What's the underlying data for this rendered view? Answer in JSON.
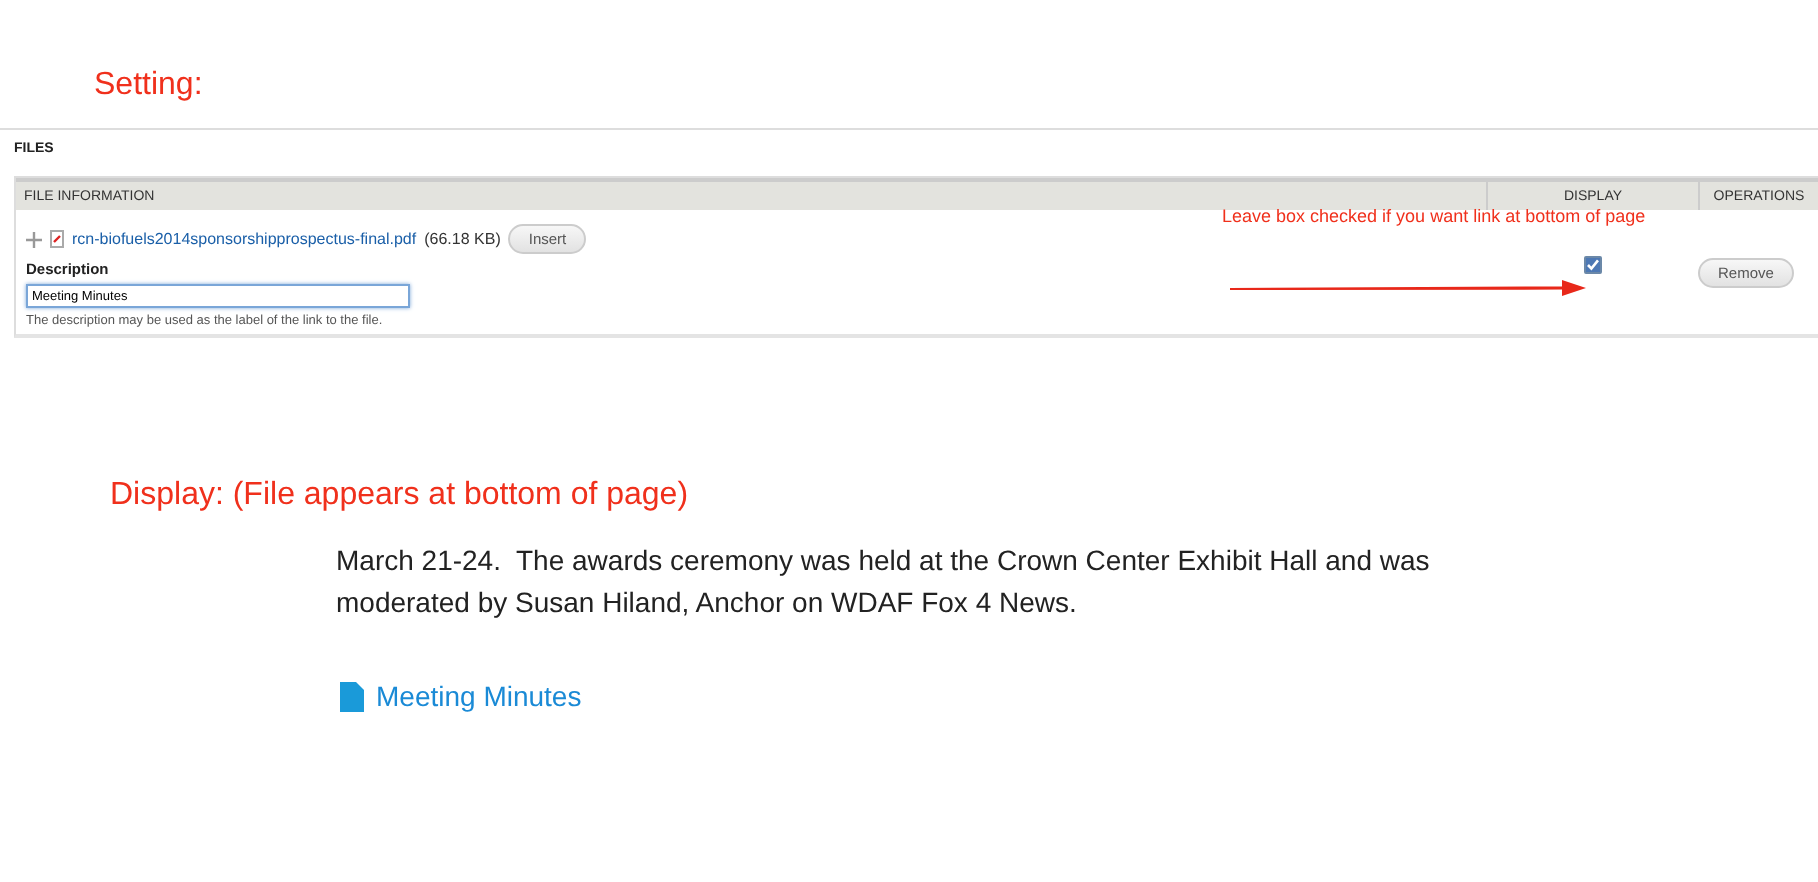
{
  "setting_heading": "Setting:",
  "files_section": {
    "title": "FILES",
    "columns": [
      "FILE INFORMATION",
      "DISPLAY",
      "OPERATIONS"
    ],
    "file": {
      "name": "rcn-biofuels2014sponsorshipprospectus-final.pdf",
      "size": "(66.18 KB)",
      "insert_button": "Insert",
      "description_label": "Description",
      "description_value": "Meeting Minutes",
      "help": "The description may be used as the label of the link to the file.",
      "display_checked": true,
      "remove_button": "Remove"
    },
    "annotation": "Leave box checked if you want link at bottom of page"
  },
  "display_heading": "Display: (File appears at bottom of page)",
  "preview": {
    "paragraph": "March 21-24.  The awards ceremony was held at the Crown Center Exhibit Hall and was moderated by Susan Hiland, Anchor on WDAF Fox 4 News.",
    "link": "Meeting Minutes"
  }
}
